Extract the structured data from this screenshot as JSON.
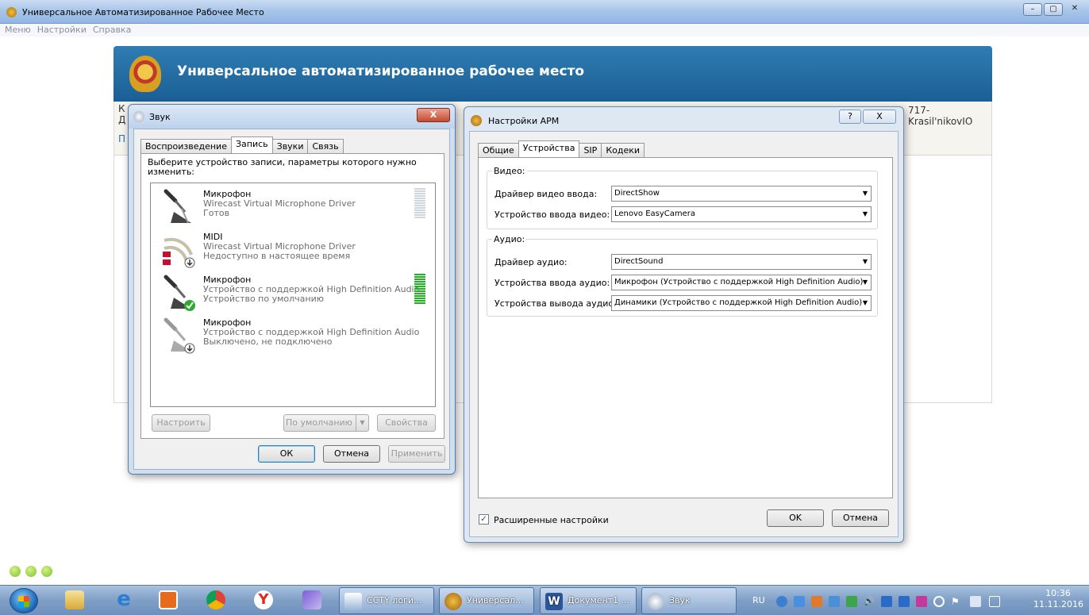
{
  "window": {
    "title": "Универсальное Автоматизированное Рабочее Место"
  },
  "menubar": [
    "Меню",
    "Настройки",
    "Справка"
  ],
  "app": {
    "header_title": "Универсальное автоматизированное рабочее место",
    "frag_k": "К",
    "frag_d": "Д",
    "frag_p": "П",
    "user_id": "717-Krasil'nikovIO"
  },
  "sound_dialog": {
    "title": "Звук",
    "close_label": "X",
    "tabs": [
      "Воспроизведение",
      "Запись",
      "Звуки",
      "Связь"
    ],
    "active_tab": 1,
    "instructions": "Выберите устройство записи, параметры которого нужно изменить:",
    "devices": [
      {
        "name": "Микрофон",
        "line2": "Wirecast Virtual Microphone Driver",
        "line3": "Готов",
        "status_icon": "none",
        "meter": "inactive"
      },
      {
        "name": "MIDI",
        "line2": "Wirecast Virtual Microphone Driver",
        "line3": "Недоступно в настоящее время",
        "status_icon": "down-arrow-icon",
        "meter": "none"
      },
      {
        "name": "Микрофон",
        "line2": "Устройство с поддержкой High Definition Audio",
        "line3": "Устройство по умолчанию",
        "status_icon": "green-check-icon",
        "meter": "active"
      },
      {
        "name": "Микрофон",
        "line2": "Устройство с поддержкой High Definition Audio",
        "line3": "Выключено, не подключено",
        "status_icon": "down-arrow-icon",
        "meter": "none"
      }
    ],
    "buttons": {
      "configure": "Настроить",
      "set_default": "По умолчанию",
      "properties": "Свойства",
      "ok": "ОК",
      "cancel": "Отмена",
      "apply": "Применить"
    }
  },
  "arm_dialog": {
    "title": "Настройки АРМ",
    "help_label": "?",
    "close_label": "X",
    "tabs": [
      "Общие",
      "Устройства",
      "SIP",
      "Кодеки"
    ],
    "active_tab": 1,
    "video": {
      "group_title": "Видео:",
      "driver_label": "Драйвер видео ввода:",
      "driver_value": "DirectShow",
      "device_label": "Устройство ввода видео:",
      "device_value": "Lenovo EasyCamera"
    },
    "audio": {
      "group_title": "Аудио:",
      "driver_label": "Драйвер аудио:",
      "driver_value": "DirectSound",
      "input_label": "Устройства ввода аудио:",
      "input_value": "Микрофон (Устройство с поддержкой High Definition Audio)",
      "output_label": "Устройства вывода аудио:",
      "output_value": "Динамики (Устройство с поддержкой High Definition Audio)"
    },
    "advanced_label": "Расширенные настройки",
    "advanced_checked": true,
    "ok": "OK",
    "cancel": "Отмена"
  },
  "taskbar": {
    "buttons": [
      "CCTY логи...",
      "Универсал...",
      "Документ1 ...",
      "Звук"
    ],
    "lang": "RU",
    "time": "10:36",
    "date": "11.11.2016"
  },
  "colors": {
    "banner": "#1a5f95",
    "taskbar": "#7f9fc6",
    "meter_active": "#22b322"
  }
}
